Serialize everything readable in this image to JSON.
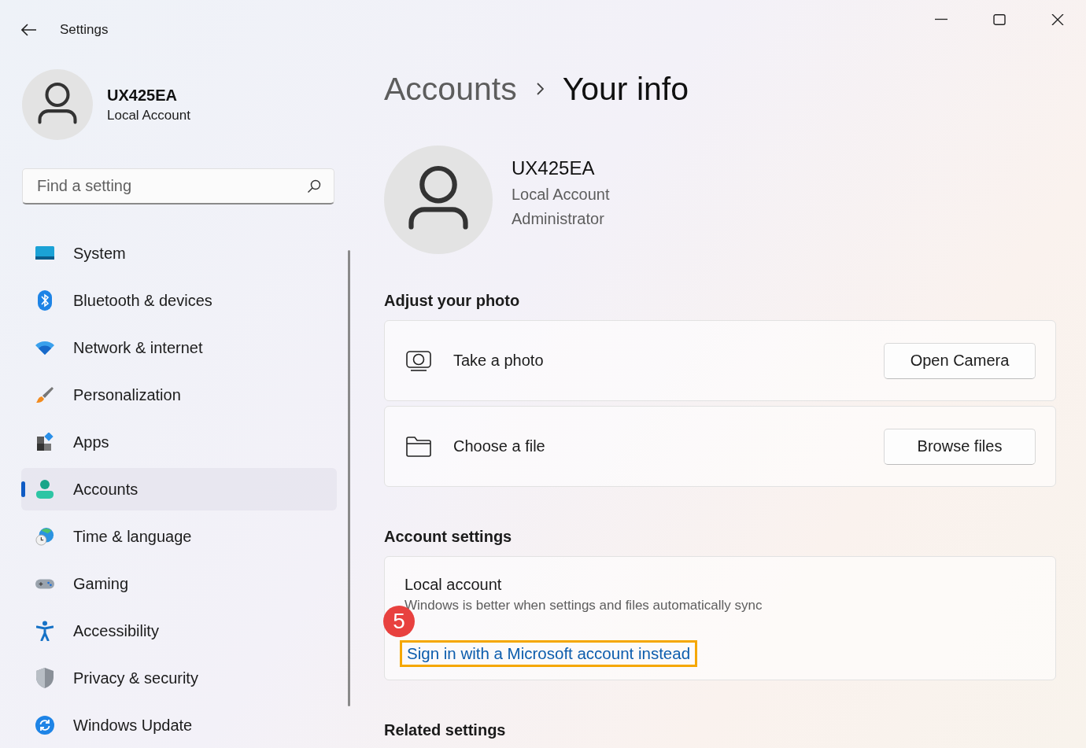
{
  "window": {
    "title": "Settings"
  },
  "user": {
    "name": "UX425EA",
    "account_type": "Local Account"
  },
  "search": {
    "placeholder": "Find a setting"
  },
  "nav": [
    {
      "label": "System",
      "kind": "system",
      "selected": false
    },
    {
      "label": "Bluetooth & devices",
      "kind": "bluetooth",
      "selected": false
    },
    {
      "label": "Network & internet",
      "kind": "network",
      "selected": false
    },
    {
      "label": "Personalization",
      "kind": "personalization",
      "selected": false
    },
    {
      "label": "Apps",
      "kind": "apps",
      "selected": false
    },
    {
      "label": "Accounts",
      "kind": "accounts",
      "selected": true
    },
    {
      "label": "Time & language",
      "kind": "time",
      "selected": false
    },
    {
      "label": "Gaming",
      "kind": "gaming",
      "selected": false
    },
    {
      "label": "Accessibility",
      "kind": "accessibility",
      "selected": false
    },
    {
      "label": "Privacy & security",
      "kind": "privacy",
      "selected": false
    },
    {
      "label": "Windows Update",
      "kind": "update",
      "selected": false
    }
  ],
  "breadcrumb": {
    "parent": "Accounts",
    "current": "Your info"
  },
  "profile": {
    "name": "UX425EA",
    "account_type": "Local Account",
    "role": "Administrator"
  },
  "photo_section": {
    "title": "Adjust your photo",
    "rows": [
      {
        "kind": "camera",
        "label": "Take a photo",
        "button": "Open Camera"
      },
      {
        "kind": "folder",
        "label": "Choose a file",
        "button": "Browse files"
      }
    ]
  },
  "account_section": {
    "title": "Account settings",
    "card_title": "Local account",
    "description": "Windows is better when settings and files automatically sync",
    "link": "Sign in with a Microsoft account instead",
    "annotation": {
      "step": "5",
      "highlighted": true
    }
  },
  "related": {
    "title": "Related settings"
  }
}
